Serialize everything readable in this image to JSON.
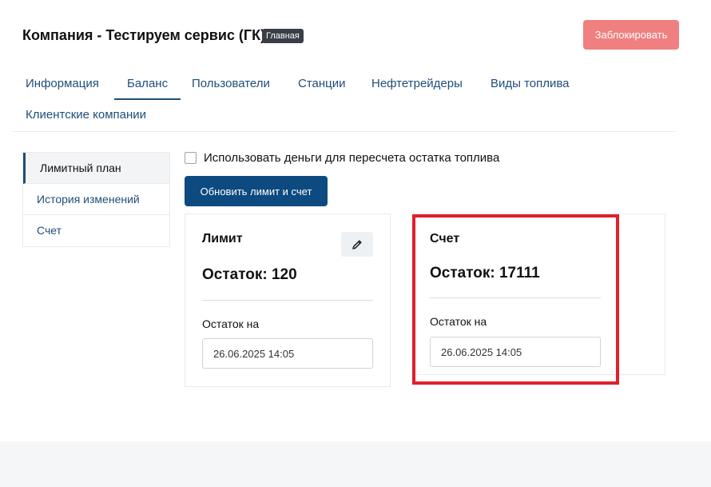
{
  "header": {
    "title": "Компания - Тестируем сервис (ГК)",
    "badge": "Главная",
    "block_button": "Заблокировать"
  },
  "tabs": [
    {
      "label": "Информация",
      "active": false
    },
    {
      "label": "Баланс",
      "active": true
    },
    {
      "label": "Пользователи",
      "active": false
    },
    {
      "label": "Станции",
      "active": false
    },
    {
      "label": "Нефтетрейдеры",
      "active": false
    },
    {
      "label": "Виды топлива",
      "active": false
    },
    {
      "label": "Клиентские компании",
      "active": false
    }
  ],
  "side_nav": [
    {
      "label": "Лимитный план",
      "active": true
    },
    {
      "label": "История изменений",
      "active": false
    },
    {
      "label": "Счет",
      "active": false
    }
  ],
  "balance": {
    "checkbox_label": "Использовать деньги для пересчета остатка топлива",
    "checkbox_checked": false,
    "update_button": "Обновить лимит и счет"
  },
  "limit_card": {
    "title": "Лимит",
    "remainder": "Остаток: 120",
    "date_label": "Остаток на",
    "date_value": "26.06.2025 14:05"
  },
  "account_card": {
    "title": "Счет",
    "remainder": "Остаток: 17111",
    "date_label": "Остаток на",
    "date_value": "26.06.2025 14:05"
  },
  "colors": {
    "brand": "#0c4a80",
    "block": "#f07f7f",
    "highlight": "#e0202a"
  }
}
